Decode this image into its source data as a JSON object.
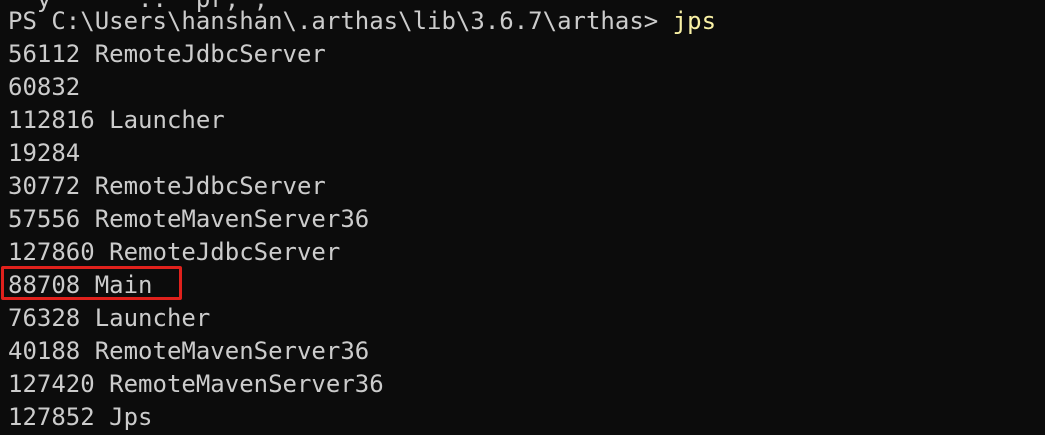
{
  "terminal": {
    "clipped_top_line": "  y      ..  pr, ,",
    "prompt": "PS C:\\Users\\hanshan\\.arthas\\lib\\3.6.7\\arthas> ",
    "command": "jps",
    "output": [
      "56112 RemoteJdbcServer",
      "60832",
      "112816 Launcher",
      "19284",
      "30772 RemoteJdbcServer",
      "57556 RemoteMavenServer36",
      "127860 RemoteJdbcServer",
      "88708 Main",
      "76328 Launcher",
      "40188 RemoteMavenServer36",
      "127420 RemoteMavenServer36",
      "127852 Jps"
    ],
    "highlighted_line": "88708 Main"
  },
  "colors": {
    "background": "#0c0c0c",
    "text": "#cccccc",
    "command": "#f9f1a5",
    "highlight_border": "#e0211c"
  }
}
